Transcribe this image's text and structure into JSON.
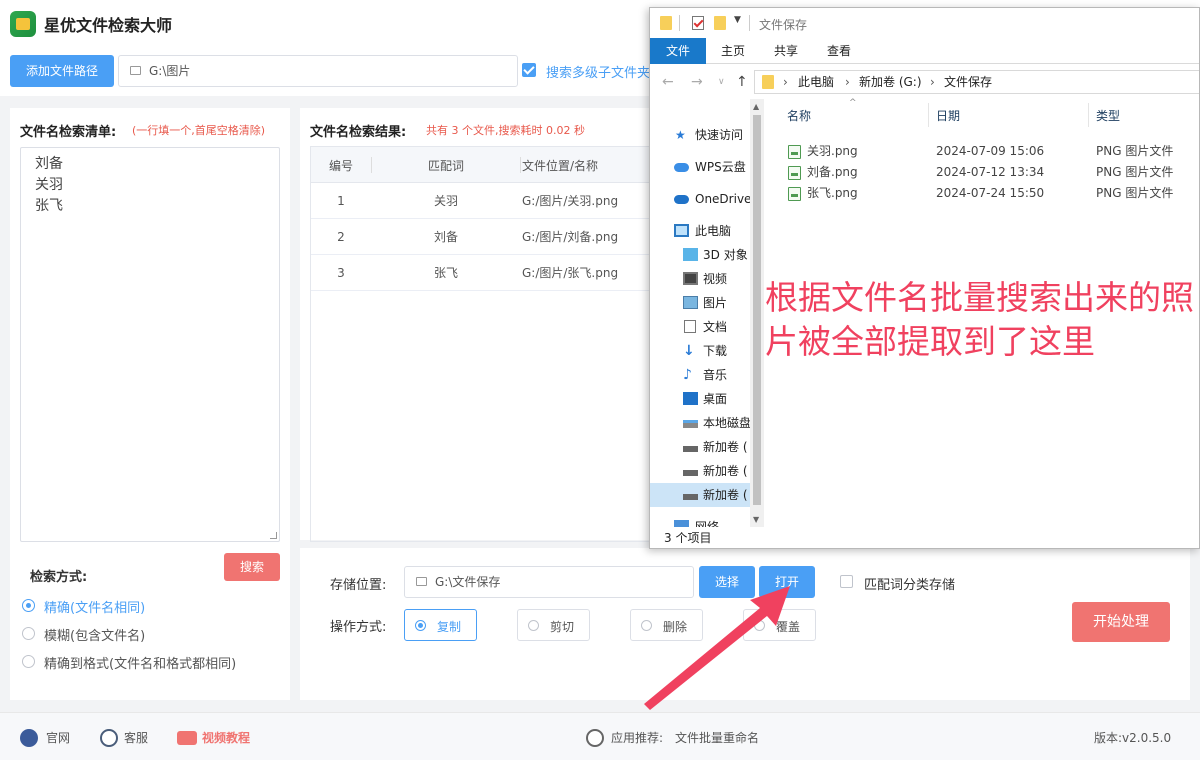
{
  "app": {
    "title": "星优文件检索大师",
    "add_path_label": "添加文件路径",
    "path_value": "G:\\图片",
    "subfolder_label": "搜索多级子文件夹"
  },
  "left": {
    "title": "文件名检索清单:",
    "hint": "(一行填一个,首尾空格清除)",
    "names": [
      "刘备",
      "关羽",
      "张飞"
    ],
    "mode_title": "检索方式:",
    "search_label": "搜索",
    "modes": [
      {
        "label": "精确(文件名相同)",
        "selected": true
      },
      {
        "label": "模糊(包含文件名)",
        "selected": false
      },
      {
        "label": "精确到格式(文件名和格式都相同)",
        "selected": false
      }
    ]
  },
  "results": {
    "title": "文件名检索结果:",
    "summary": "共有 3 个文件,搜索耗时 0.02 秒",
    "columns": [
      "编号",
      "匹配词",
      "文件位置/名称"
    ],
    "rows": [
      {
        "no": "1",
        "keyword": "关羽",
        "path": "G:/图片/关羽.png"
      },
      {
        "no": "2",
        "keyword": "刘备",
        "path": "G:/图片/刘备.png"
      },
      {
        "no": "3",
        "keyword": "张飞",
        "path": "G:/图片/张飞.png"
      }
    ]
  },
  "ops": {
    "save_label": "存储位置:",
    "save_value": "G:\\文件保存",
    "select_label": "选择",
    "open_label": "打开",
    "classify_label": "匹配词分类存储",
    "op_label": "操作方式:",
    "operations": [
      {
        "label": "复制",
        "selected": true
      },
      {
        "label": "剪切",
        "selected": false
      },
      {
        "label": "删除",
        "selected": false
      },
      {
        "label": "覆盖",
        "selected": false
      }
    ],
    "start_label": "开始处理"
  },
  "footer": {
    "website": "官网",
    "service": "客服",
    "video": "视频教程",
    "recommend_label": "应用推荐:",
    "recommend_app": "文件批量重命名",
    "version": "版本:v2.0.5.0"
  },
  "explorer": {
    "window_title": "文件保存",
    "ribbon_tabs": [
      "文件",
      "主页",
      "共享",
      "查看"
    ],
    "breadcrumb": [
      "此电脑",
      "新加卷 (G:)",
      "文件保存"
    ],
    "nav_items": [
      {
        "label": "快速访问",
        "icon": "star-icon"
      },
      {
        "label": "WPS云盘",
        "icon": "cloud-icon"
      },
      {
        "label": "OneDrive",
        "icon": "onedrive-icon"
      },
      {
        "label": "此电脑",
        "icon": "computer-icon"
      },
      {
        "label": "3D 对象",
        "icon": "cube-icon"
      },
      {
        "label": "视频",
        "icon": "video-icon"
      },
      {
        "label": "图片",
        "icon": "picture-icon"
      },
      {
        "label": "文档",
        "icon": "document-icon"
      },
      {
        "label": "下载",
        "icon": "download-icon"
      },
      {
        "label": "音乐",
        "icon": "music-icon"
      },
      {
        "label": "桌面",
        "icon": "desktop-icon"
      },
      {
        "label": "本地磁盘",
        "icon": "disk-icon"
      },
      {
        "label": "新加卷 (",
        "icon": "drive-icon"
      },
      {
        "label": "新加卷 (",
        "icon": "drive-icon"
      },
      {
        "label": "新加卷 (",
        "icon": "drive-icon"
      },
      {
        "label": "网络",
        "icon": "network-icon"
      }
    ],
    "columns": [
      "名称",
      "日期",
      "类型"
    ],
    "files": [
      {
        "name": "关羽.png",
        "date": "2024-07-09 15:06",
        "type": "PNG 图片文件"
      },
      {
        "name": "刘备.png",
        "date": "2024-07-12 13:34",
        "type": "PNG 图片文件"
      },
      {
        "name": "张飞.png",
        "date": "2024-07-24 15:50",
        "type": "PNG 图片文件"
      }
    ],
    "status": "3 个项目"
  },
  "annotation": "根据文件名批量搜索出来的照片被全部提取到了这里",
  "colors": {
    "primary": "#4a9ff5",
    "danger": "#f07471",
    "annotation": "#f0415f",
    "selected_nav": "#cce4f7"
  }
}
